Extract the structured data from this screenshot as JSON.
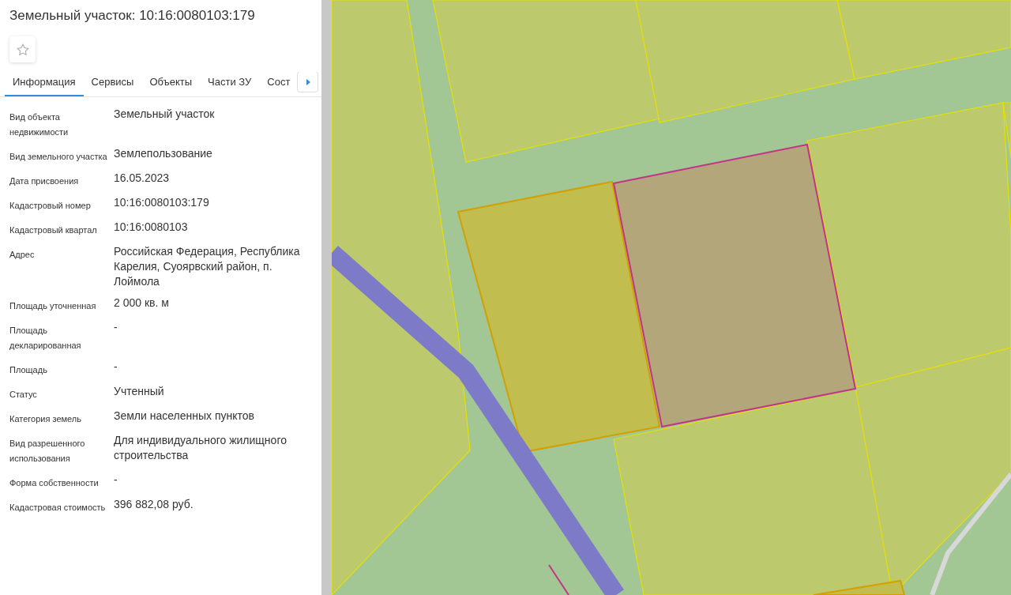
{
  "title": "Земельный участок: 10:16:0080103:179",
  "favorite": {
    "on": false
  },
  "tabs": [
    {
      "label": "Информация",
      "selected": true
    },
    {
      "label": "Сервисы",
      "selected": false
    },
    {
      "label": "Объекты",
      "selected": false
    },
    {
      "label": "Части ЗУ",
      "selected": false
    },
    {
      "label": "Сост",
      "selected": false
    }
  ],
  "fields": [
    {
      "label": "Вид объекта недвижимости",
      "value": "Земельный участок"
    },
    {
      "label": "Вид земельного участка",
      "value": "Землепользование"
    },
    {
      "label": "Дата присвоения",
      "value": "16.05.2023"
    },
    {
      "label": "Кадастровый номер",
      "value": "10:16:0080103:179"
    },
    {
      "label": "Кадастровый квартал",
      "value": "10:16:0080103"
    },
    {
      "label": "Адрес",
      "value": "Российская Федерация, Республика Карелия, Суоярвский район, п. Лоймола"
    },
    {
      "label": "Площадь уточненная",
      "value": "2 000 кв. м"
    },
    {
      "label": "Площадь декларированная",
      "value": "-"
    },
    {
      "label": "Площадь",
      "value": "-"
    },
    {
      "label": "Статус",
      "value": "Учтенный"
    },
    {
      "label": "Категория земель",
      "value": "Земли населенных пунктов"
    },
    {
      "label": "Вид разрешенного использования",
      "value": "Для индивидуального жилищного строительства"
    },
    {
      "label": "Форма собственности",
      "value": "-"
    },
    {
      "label": "Кадастровая стоимость",
      "value": "396 882,08 руб."
    }
  ]
}
